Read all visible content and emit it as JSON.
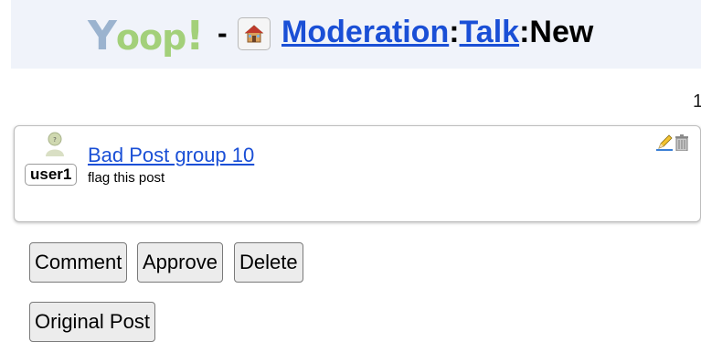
{
  "header": {
    "logo_text": "Yoop!",
    "separator": "-",
    "crumbs": [
      "Moderation",
      "Talk",
      "New"
    ],
    "crumb_sep": ":"
  },
  "page_indicator": "1",
  "post": {
    "user": "user1",
    "title": "Bad Post group 10",
    "body": "flag this post"
  },
  "actions": {
    "comment": "Comment",
    "approve": "Approve",
    "delete": "Delete",
    "original_post": "Original Post"
  }
}
